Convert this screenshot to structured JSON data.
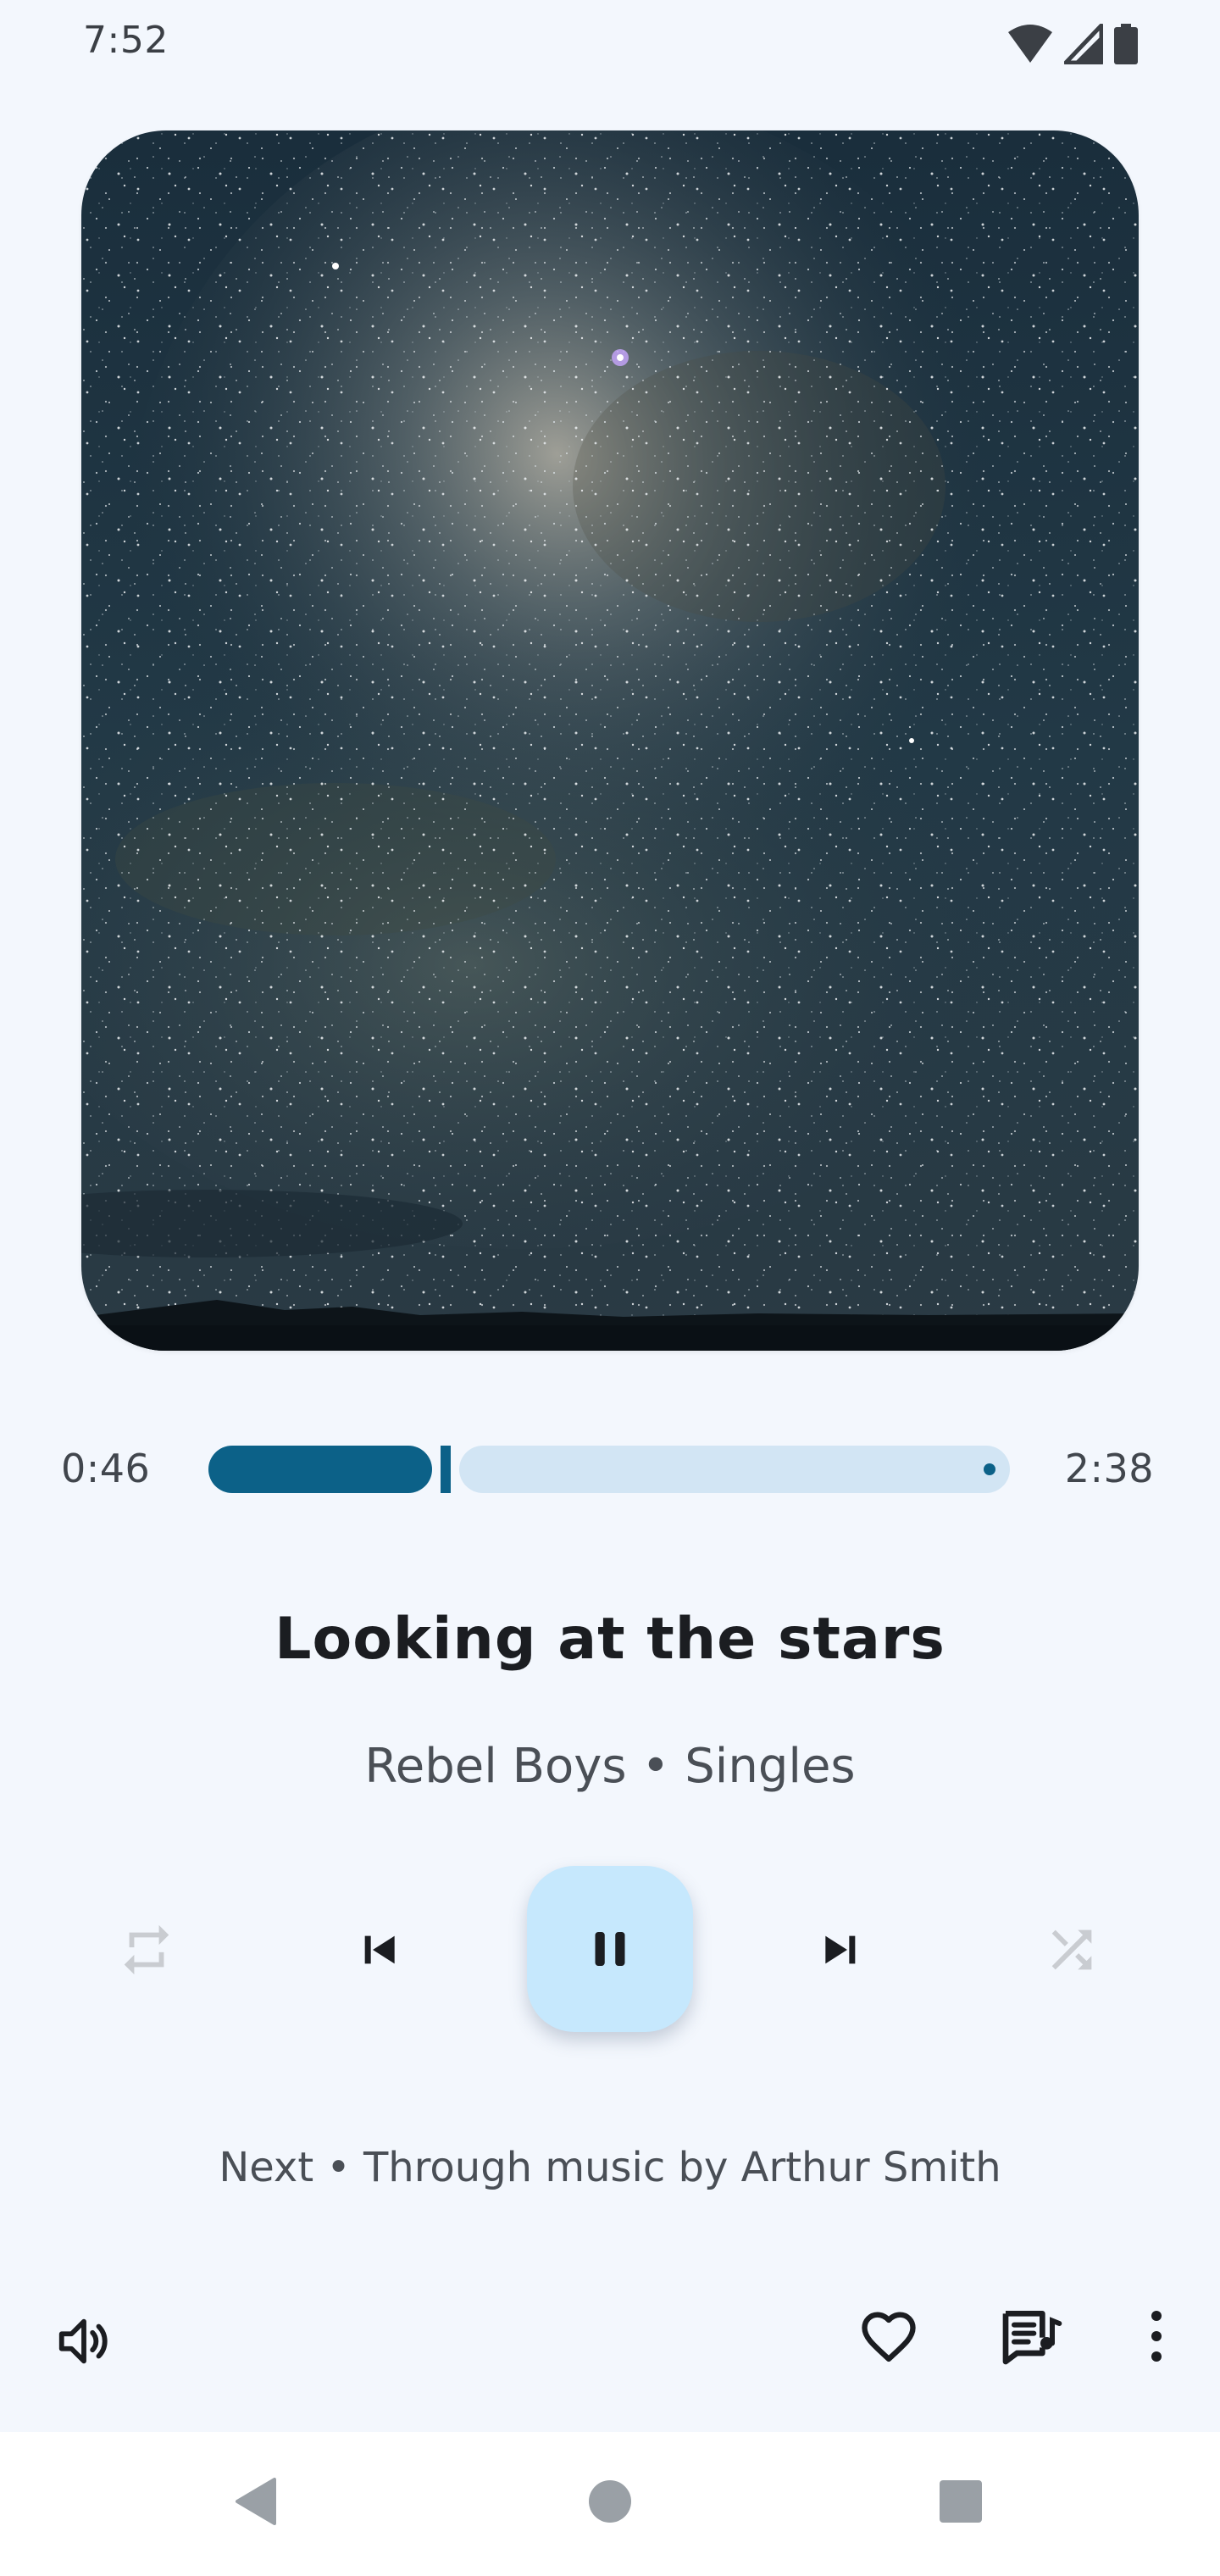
{
  "status_bar": {
    "time": "7:52",
    "icons": [
      "wifi-icon",
      "signal-icon",
      "battery-icon"
    ]
  },
  "artwork": {
    "description_icon": "album-art"
  },
  "player": {
    "elapsed": "0:46",
    "total": "2:38",
    "progress_fraction": 0.29,
    "title": "Looking at the stars",
    "artist": "Rebel Boys",
    "album": "Singles",
    "subtitle": "Rebel Boys • Singles",
    "next_up": "Next • Through music by Arthur Smith"
  },
  "controls": {
    "repeat_icon": "repeat-icon",
    "prev_icon": "skip-previous-icon",
    "play_pause_icon": "pause-icon",
    "next_icon": "skip-next-icon",
    "shuffle_icon": "shuffle-icon"
  },
  "actions": {
    "volume_icon": "volume-icon",
    "favorite_icon": "heart-icon",
    "lyrics_icon": "lyrics-icon",
    "more_icon": "more-vert-icon"
  },
  "colors": {
    "accent": "#0c6188",
    "track_inactive": "#d2e5f4",
    "play_button_bg": "#c6e8fd",
    "background": "#f3f7fd",
    "disabled_icon": "#c9ccd1"
  },
  "nav": {
    "back_icon": "back-icon",
    "home_icon": "home-icon",
    "recents_icon": "recents-icon"
  }
}
